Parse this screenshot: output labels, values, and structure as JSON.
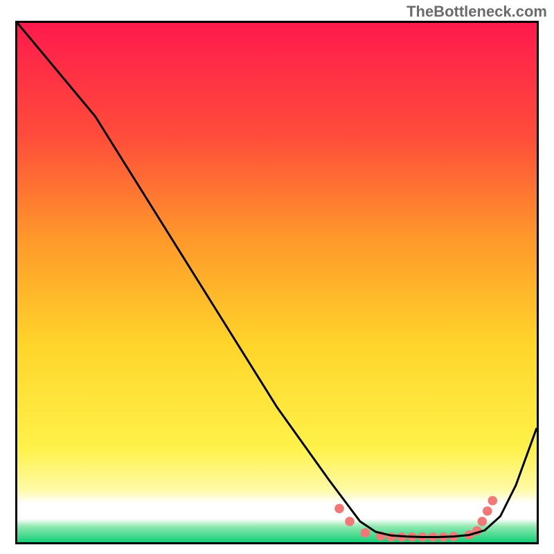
{
  "watermark": "TheBottleneck.com",
  "chart_data": {
    "type": "line",
    "title": "",
    "xlabel": "",
    "ylabel": "",
    "xlim": [
      0,
      100
    ],
    "ylim": [
      0,
      100
    ],
    "background_gradient": {
      "top": "#ff1a4d",
      "mid_upper": "#ff8a2a",
      "mid": "#ffd52a",
      "lower": "#fff56b",
      "white_band": [
        4,
        8
      ],
      "bottom": "#14cf78"
    },
    "series": [
      {
        "name": "curve",
        "color": "#000000",
        "x": [
          0,
          5,
          10,
          15,
          20,
          25,
          30,
          35,
          40,
          45,
          50,
          55,
          60,
          63,
          66,
          69,
          72,
          75,
          78,
          81,
          84,
          87,
          90,
          93,
          96,
          100
        ],
        "y": [
          100,
          94,
          88,
          82,
          74,
          66,
          58,
          50,
          42,
          34,
          26,
          19,
          12,
          8,
          4,
          2,
          1.3,
          1.1,
          1.0,
          1.0,
          1.1,
          1.4,
          2.3,
          5,
          11,
          22
        ]
      }
    ],
    "markers": {
      "name": "dots",
      "color": "#f27878",
      "radius_pct": 0.9,
      "x": [
        62,
        64,
        67,
        70,
        72,
        74,
        76,
        78,
        80,
        82,
        84,
        87,
        88.5,
        89.5,
        90.5,
        91.5
      ],
      "y": [
        6.5,
        4.0,
        1.8,
        1.2,
        1.0,
        1.0,
        1.0,
        1.0,
        1.0,
        1.0,
        1.1,
        1.4,
        2.2,
        4.0,
        6.0,
        8.0
      ]
    }
  }
}
